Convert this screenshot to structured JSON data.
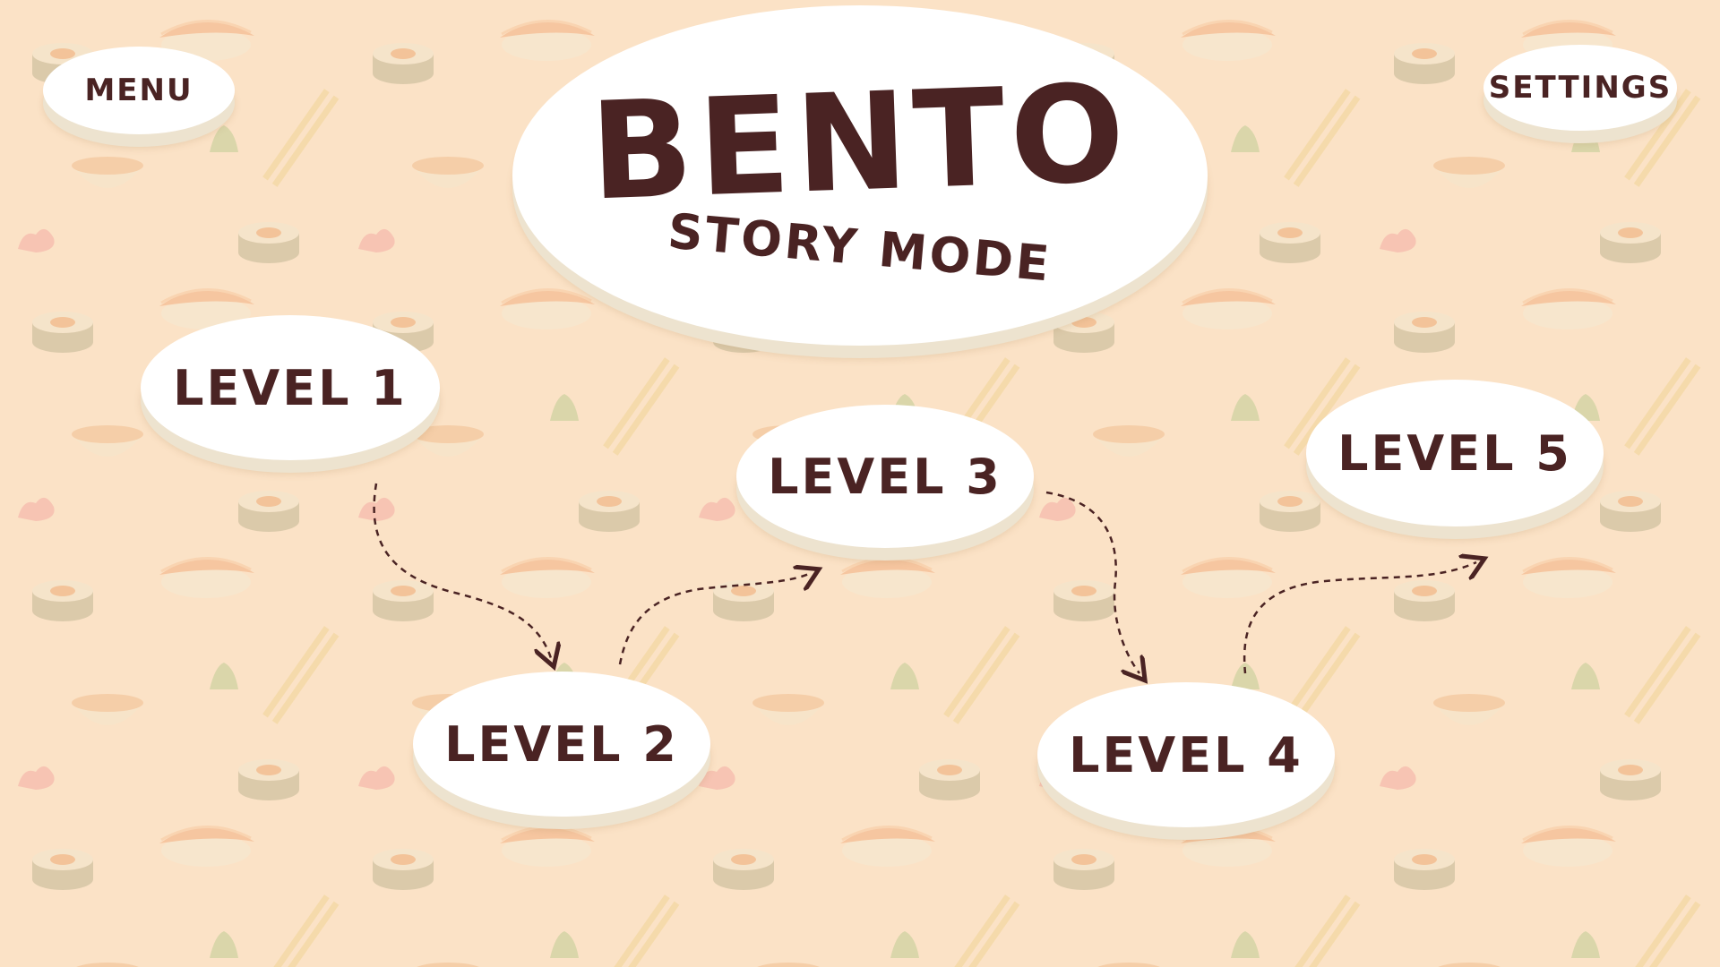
{
  "header": {
    "menu_label": "MENU",
    "settings_label": "SETTINGS"
  },
  "title": {
    "main": "BENTO",
    "subtitle": "STORY MODE"
  },
  "levels": [
    {
      "label": "LEVEL 1"
    },
    {
      "label": "LEVEL 2"
    },
    {
      "label": "LEVEL 3"
    },
    {
      "label": "LEVEL 4"
    },
    {
      "label": "LEVEL 5"
    }
  ],
  "colors": {
    "background": "#fbe2c6",
    "bubble": "#ffffff",
    "bubble_shadow": "#ede3cf",
    "text": "#4a2323",
    "path": "#4a2323"
  },
  "background_icons": [
    "sushi-roll-icon",
    "nigiri-icon",
    "chopsticks-icon",
    "tea-bowl-icon",
    "wasabi-icon",
    "ginger-icon"
  ]
}
